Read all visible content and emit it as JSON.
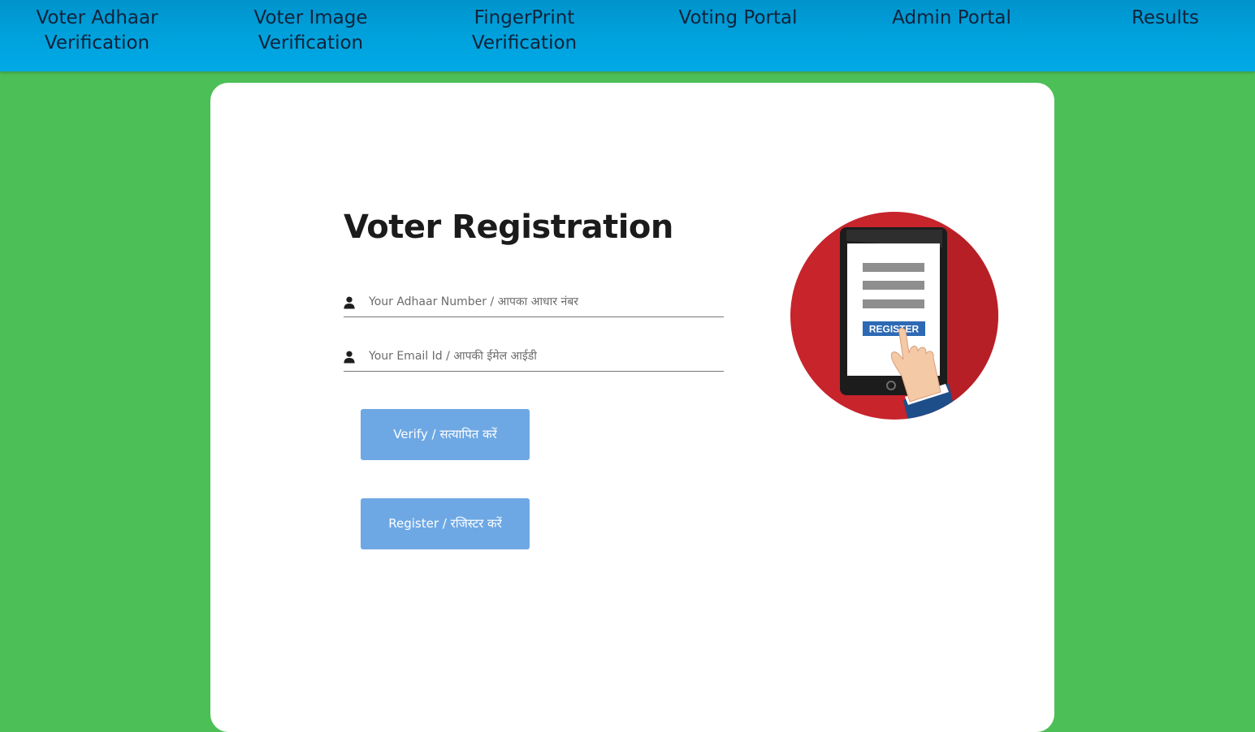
{
  "nav": {
    "items": [
      {
        "line1": "Voter Adhaar",
        "line2": "Verification"
      },
      {
        "line1": "Voter Image",
        "line2": "Verification"
      },
      {
        "line1": "FingerPrint",
        "line2": "Verification"
      },
      {
        "line1": "Voting Portal",
        "line2": ""
      },
      {
        "line1": "Admin Portal",
        "line2": ""
      },
      {
        "line1": "Results",
        "line2": ""
      }
    ]
  },
  "form": {
    "title": "Voter Registration",
    "adhaar": {
      "placeholder": "Your Adhaar Number / आपका आधार नंबर",
      "value": "",
      "icon": "user-icon"
    },
    "email": {
      "placeholder": "Your Email Id / आपकी ईमेल आईडी",
      "value": "",
      "icon": "user-icon"
    },
    "verify_label": "Verify / सत्यापित करें",
    "register_label": "Register / रजिस्टर करें"
  },
  "illustration": {
    "button_text": "REGISTER",
    "icon": "tablet-register-icon"
  },
  "colors": {
    "background": "#4cbf56",
    "nav": "#00a2dd",
    "button": "#6ea8e4",
    "circle": "#c7242c"
  }
}
